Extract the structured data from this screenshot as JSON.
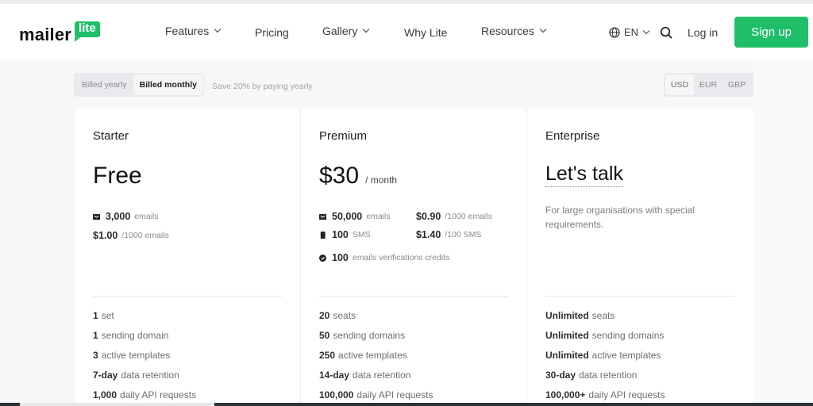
{
  "header": {
    "logo": {
      "word": "mailer",
      "badge": "lite"
    },
    "nav": [
      {
        "label": "Features",
        "has_dropdown": true
      },
      {
        "label": "Pricing",
        "has_dropdown": false
      },
      {
        "label": "Gallery",
        "has_dropdown": true
      },
      {
        "label": "Why Lite",
        "has_dropdown": false
      },
      {
        "label": "Resources",
        "has_dropdown": true
      }
    ],
    "language": "EN",
    "login_label": "Log in",
    "signup_label": "Sign up",
    "accent_color": "#1fbf69"
  },
  "billing": {
    "options": [
      "Billed yearly",
      "Billed monthly"
    ],
    "selected": "Billed monthly",
    "save_note": "Save 20% by paying yearly"
  },
  "currency": {
    "options": [
      "USD",
      "EUR",
      "GBP"
    ],
    "selected": "USD"
  },
  "plans": [
    {
      "name": "Starter",
      "price": "Free",
      "emails_value": "3,000",
      "emails_label": "emails",
      "extra_price": "$1.00",
      "extra_unit": "/1000 emails",
      "features": [
        {
          "bold": "1",
          "text": "set"
        },
        {
          "bold": "1",
          "text": "sending domain"
        },
        {
          "bold": "3",
          "text": "active templates"
        },
        {
          "bold": "7-day",
          "text": "data retention"
        },
        {
          "bold": "1,000",
          "text": "daily API requests"
        }
      ]
    },
    {
      "name": "Premium",
      "price": "$30",
      "period": "/ month",
      "emails_value": "50,000",
      "emails_label": "emails",
      "sms_value": "100",
      "sms_label": "SMS",
      "verif_value": "100",
      "verif_label": "emails verifications credits",
      "extra_email_price": "$0.90",
      "extra_email_unit": "/1000 emails",
      "extra_sms_price": "$1.40",
      "extra_sms_unit": "/100 SMS",
      "features": [
        {
          "bold": "20",
          "text": "seats"
        },
        {
          "bold": "50",
          "text": "sending domains"
        },
        {
          "bold": "250",
          "text": "active templates"
        },
        {
          "bold": "14-day",
          "text": "data retention"
        },
        {
          "bold": "100,000",
          "text": "daily API requests"
        }
      ]
    },
    {
      "name": "Enterprise",
      "price": "Let's talk",
      "description": "For large organisations with special requirements.",
      "features": [
        {
          "bold": "Unlimited",
          "text": "seats"
        },
        {
          "bold": "Unlimited",
          "text": "sending domains"
        },
        {
          "bold": "Unlimited",
          "text": "active templates"
        },
        {
          "bold": "30-day",
          "text": "data retention"
        },
        {
          "bold": "100,000+",
          "text": "daily API requests"
        }
      ]
    }
  ]
}
